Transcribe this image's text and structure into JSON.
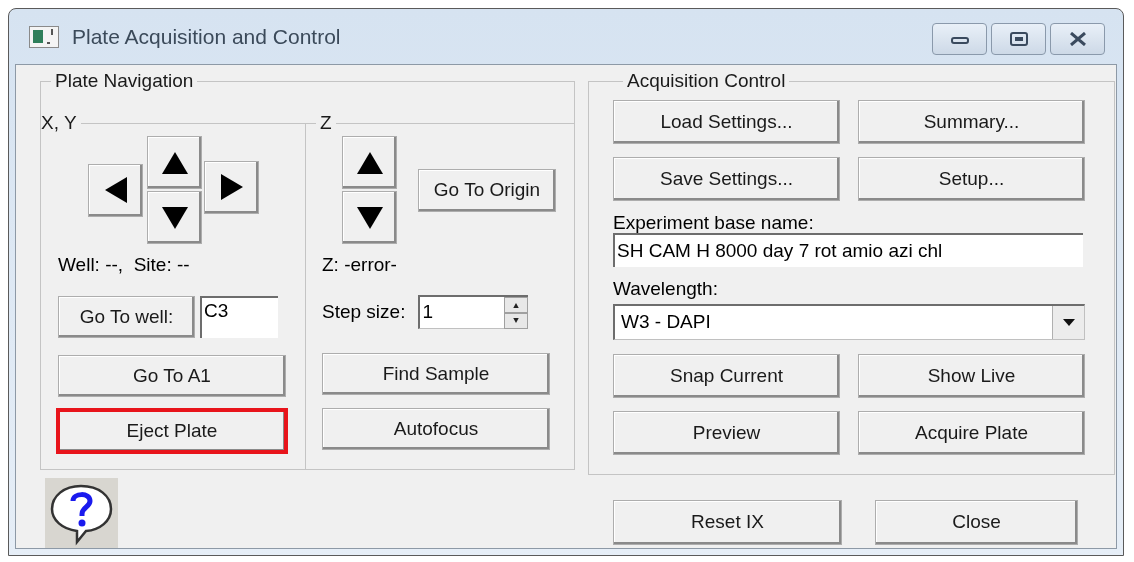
{
  "window": {
    "title": "Plate Acquisition and Control"
  },
  "plate_navigation": {
    "title": "Plate Navigation",
    "xy": {
      "title": "X, Y",
      "status": "Well: --,  Site: --",
      "go_to_well_button": "Go To well:",
      "well_field": {
        "value": "C3"
      },
      "buttons": [
        {
          "label": "Go To A1",
          "highlighted": false
        },
        {
          "label": "Eject Plate",
          "highlighted": true
        }
      ]
    },
    "z": {
      "title": "Z",
      "go_to_origin_button": "Go To Origin",
      "status": "Z: -error-",
      "step_size": {
        "label": "Step size:",
        "value": "1"
      },
      "buttons": [
        {
          "label": "Find Sample",
          "highlighted": false
        },
        {
          "label": "Autofocus",
          "highlighted": false
        }
      ]
    }
  },
  "acquisition_control": {
    "title": "Acquisition Control",
    "top_buttons": [
      {
        "label": "Load Settings..."
      },
      {
        "label": "Summary..."
      },
      {
        "label": "Save Settings..."
      },
      {
        "label": "Setup..."
      }
    ],
    "experiment": {
      "label": "Experiment base name:",
      "value": "SH CAM H 8000 day 7 rot amio azi chl"
    },
    "wavelength": {
      "label": "Wavelength:",
      "value": "W3 - DAPI"
    },
    "bottom_buttons": [
      {
        "label": "Snap Current"
      },
      {
        "label": "Show Live"
      },
      {
        "label": "Preview"
      },
      {
        "label": "Acquire Plate"
      }
    ]
  },
  "footer_buttons": [
    {
      "label": "Reset IX"
    },
    {
      "label": "Close"
    }
  ]
}
